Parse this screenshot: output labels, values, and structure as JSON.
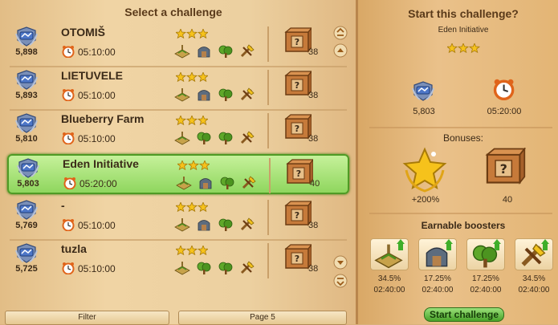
{
  "left_panel": {
    "title": "Select a challenge",
    "rows": [
      {
        "name": "OTOMIŠ",
        "score": "5,898",
        "time": "05:10:00",
        "stars": 3,
        "boosters": [
          "farm-booster-icon",
          "barn-booster-icon",
          "tree-booster-icon",
          "tools-booster-icon"
        ],
        "crate_count": "38",
        "selected": false
      },
      {
        "name": "LIETUVELE",
        "score": "5,893",
        "time": "05:10:00",
        "stars": 3,
        "boosters": [
          "farm-booster-icon",
          "barn-booster-icon",
          "tree-booster-icon",
          "tools-booster-icon"
        ],
        "crate_count": "38",
        "selected": false
      },
      {
        "name": "Blueberry Farm",
        "score": "5,810",
        "time": "05:10:00",
        "stars": 3,
        "boosters": [
          "farm-booster-icon",
          "tree-booster-icon",
          "tree-booster-icon",
          "tools-booster-icon"
        ],
        "crate_count": "38",
        "selected": false
      },
      {
        "name": "Eden Initiative",
        "score": "5,803",
        "time": "05:20:00",
        "stars": 3,
        "boosters": [
          "farm-booster-icon",
          "barn-booster-icon",
          "tree-booster-icon",
          "tools-booster-icon"
        ],
        "crate_count": "40",
        "selected": true
      },
      {
        "name": "-",
        "score": "5,769",
        "time": "05:10:00",
        "stars": 3,
        "boosters": [
          "farm-booster-icon",
          "barn-booster-icon",
          "tree-booster-icon",
          "tools-booster-icon"
        ],
        "crate_count": "38",
        "selected": false
      },
      {
        "name": "tuzla",
        "score": "5,725",
        "time": "05:10:00",
        "stars": 3,
        "boosters": [
          "farm-booster-icon",
          "tree-booster-icon",
          "tree-booster-icon",
          "tools-booster-icon"
        ],
        "crate_count": "38",
        "selected": false
      }
    ],
    "filter_label": "Filter",
    "page_label": "Page 5"
  },
  "right_panel": {
    "title": "Start this challenge?",
    "challenge_name": "Eden Initiative",
    "stars": 3,
    "score": "5,803",
    "time": "05:20:00",
    "bonuses_title": "Bonuses:",
    "bonus_percent": "+200%",
    "bonus_crates": "40",
    "boosters_title": "Earnable boosters",
    "boosters": [
      {
        "icon": "farm-booster-icon",
        "percent": "34.5%",
        "duration": "02:40:00"
      },
      {
        "icon": "barn-booster-icon",
        "percent": "17.25%",
        "duration": "02:40:00"
      },
      {
        "icon": "tree-booster-icon",
        "percent": "17.25%",
        "duration": "02:40:00"
      },
      {
        "icon": "tools-booster-icon",
        "percent": "34.5%",
        "duration": "02:40:00"
      }
    ],
    "start_button": "Start challenge"
  },
  "colors": {
    "selected_row": "#8fd65e",
    "panel": "#eac18a",
    "text": "#3b2a18"
  }
}
